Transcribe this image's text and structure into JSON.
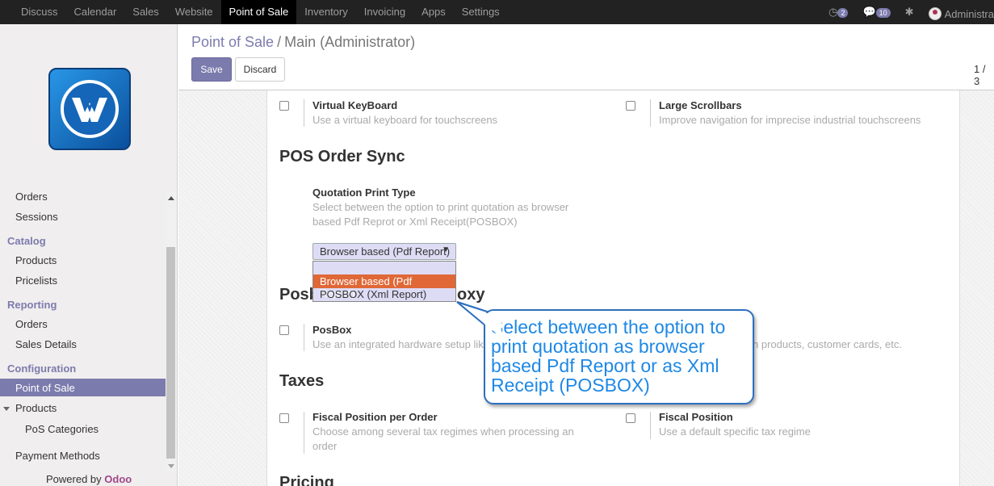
{
  "topnav": {
    "items": [
      "Discuss",
      "Calendar",
      "Sales",
      "Website",
      "Point of Sale",
      "Inventory",
      "Invoicing",
      "Apps",
      "Settings"
    ],
    "active": "Point of Sale"
  },
  "systray": {
    "messages_count": "2",
    "activities_count": "10",
    "user": "Administra"
  },
  "sidebar": {
    "items": {
      "orders": "Orders",
      "sessions": "Sessions",
      "catalog": "Catalog",
      "products": "Products",
      "pricelists": "Pricelists",
      "reporting": "Reporting",
      "reporting_orders": "Orders",
      "sales_details": "Sales Details",
      "configuration": "Configuration",
      "point_of_sale": "Point of Sale",
      "config_products": "Products",
      "pos_categories": "PoS Categories",
      "payment_methods": "Payment Methods"
    },
    "powered_by": "Powered by",
    "brand": "Odoo"
  },
  "control_panel": {
    "breadcrumb_parent": "Point of Sale",
    "breadcrumb_sep": "/",
    "breadcrumb_current": "Main (Administrator)",
    "save": "Save",
    "discard": "Discard",
    "pager": "1 / 3"
  },
  "settings": {
    "virtual_keyboard": {
      "title": "Virtual KeyBoard",
      "desc": "Use a virtual keyboard for touchscreens"
    },
    "large_scrollbars": {
      "title": "Large Scrollbars",
      "desc": "Improve navigation for imprecise industrial touchscreens"
    },
    "pos_order_sync": "POS Order Sync",
    "quotation_print_type": {
      "title": "Quotation Print Type",
      "desc_line1": "Select between the option to print quotation as browser",
      "desc_line2": "based Pdf Reprot or Xml Receipt(POSBOX)",
      "selected": "Browser based (Pdf Report)",
      "options": [
        "Browser based (Pdf Report)",
        "POSBOX (Xml Report)"
      ]
    },
    "posbox_section_pre": "Posb",
    "posbox_section_post": "oxy",
    "posbox": {
      "title": "PosBox",
      "desc_left": "Use an integrated hardware setup lik",
      "desc_right": "n products, customer cards, etc."
    },
    "taxes": "Taxes",
    "fiscal_position_per_order": {
      "title": "Fiscal Position per Order",
      "desc_line1": "Choose among several tax regimes when processing an",
      "desc_line2": "order"
    },
    "fiscal_position": {
      "title": "Fiscal Position",
      "desc": "Use a default specific tax regime"
    },
    "pricing": "Pricing"
  },
  "callout": {
    "text": "Select between the option to print quotation as browser based Pdf Report or as Xml Receipt (POSBOX)"
  }
}
